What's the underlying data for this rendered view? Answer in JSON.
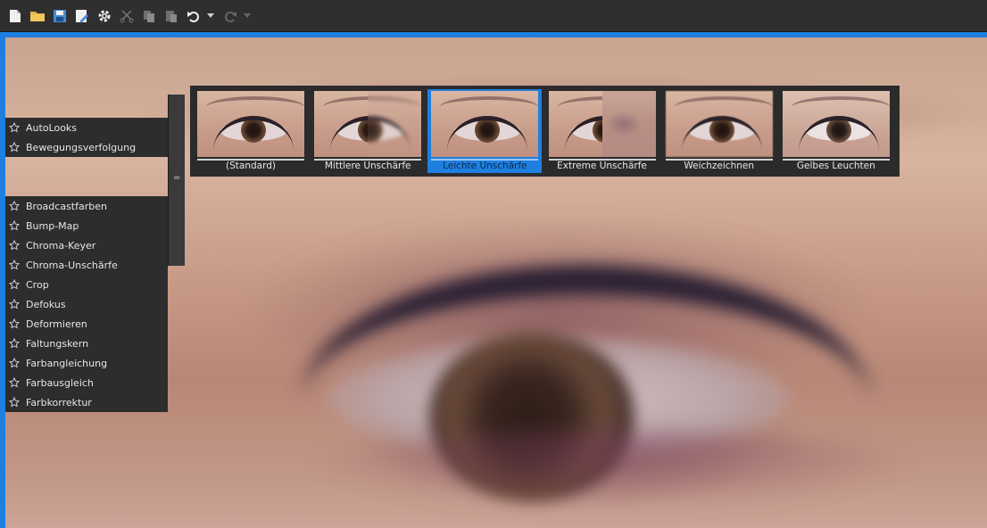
{
  "toolbar": {
    "buttons": [
      {
        "name": "new-file-icon"
      },
      {
        "name": "open-folder-icon"
      },
      {
        "name": "save-icon"
      },
      {
        "name": "save-as-icon"
      },
      {
        "name": "settings-gear-icon"
      },
      {
        "name": "cut-icon"
      },
      {
        "name": "copy-icon"
      },
      {
        "name": "paste-icon"
      },
      {
        "name": "undo-icon"
      },
      {
        "name": "redo-icon"
      }
    ]
  },
  "effects": {
    "top_group": [
      "AutoLooks",
      "Bewegungsverfolgung"
    ],
    "main_group": [
      "Broadcastfarben",
      "Bump-Map",
      "Chroma-Keyer",
      "Chroma-Unschärfe",
      "Crop",
      "Defokus",
      "Deformieren",
      "Faltungskern",
      "Farbangleichung",
      "Farbausgleich",
      "Farbkorrektur"
    ]
  },
  "presets": {
    "items": [
      {
        "label": "(Standard)",
        "selected": false
      },
      {
        "label": "Mittlere Unschärfe",
        "selected": false
      },
      {
        "label": "Leichte Unschärfe",
        "selected": true
      },
      {
        "label": "Extreme Unschärfe",
        "selected": false
      },
      {
        "label": "Weichzeichnen",
        "selected": false
      },
      {
        "label": "Gelbes Leuchten",
        "selected": false
      }
    ]
  },
  "colors": {
    "accent": "#1e7fe0",
    "panel": "#2d2d2d"
  }
}
